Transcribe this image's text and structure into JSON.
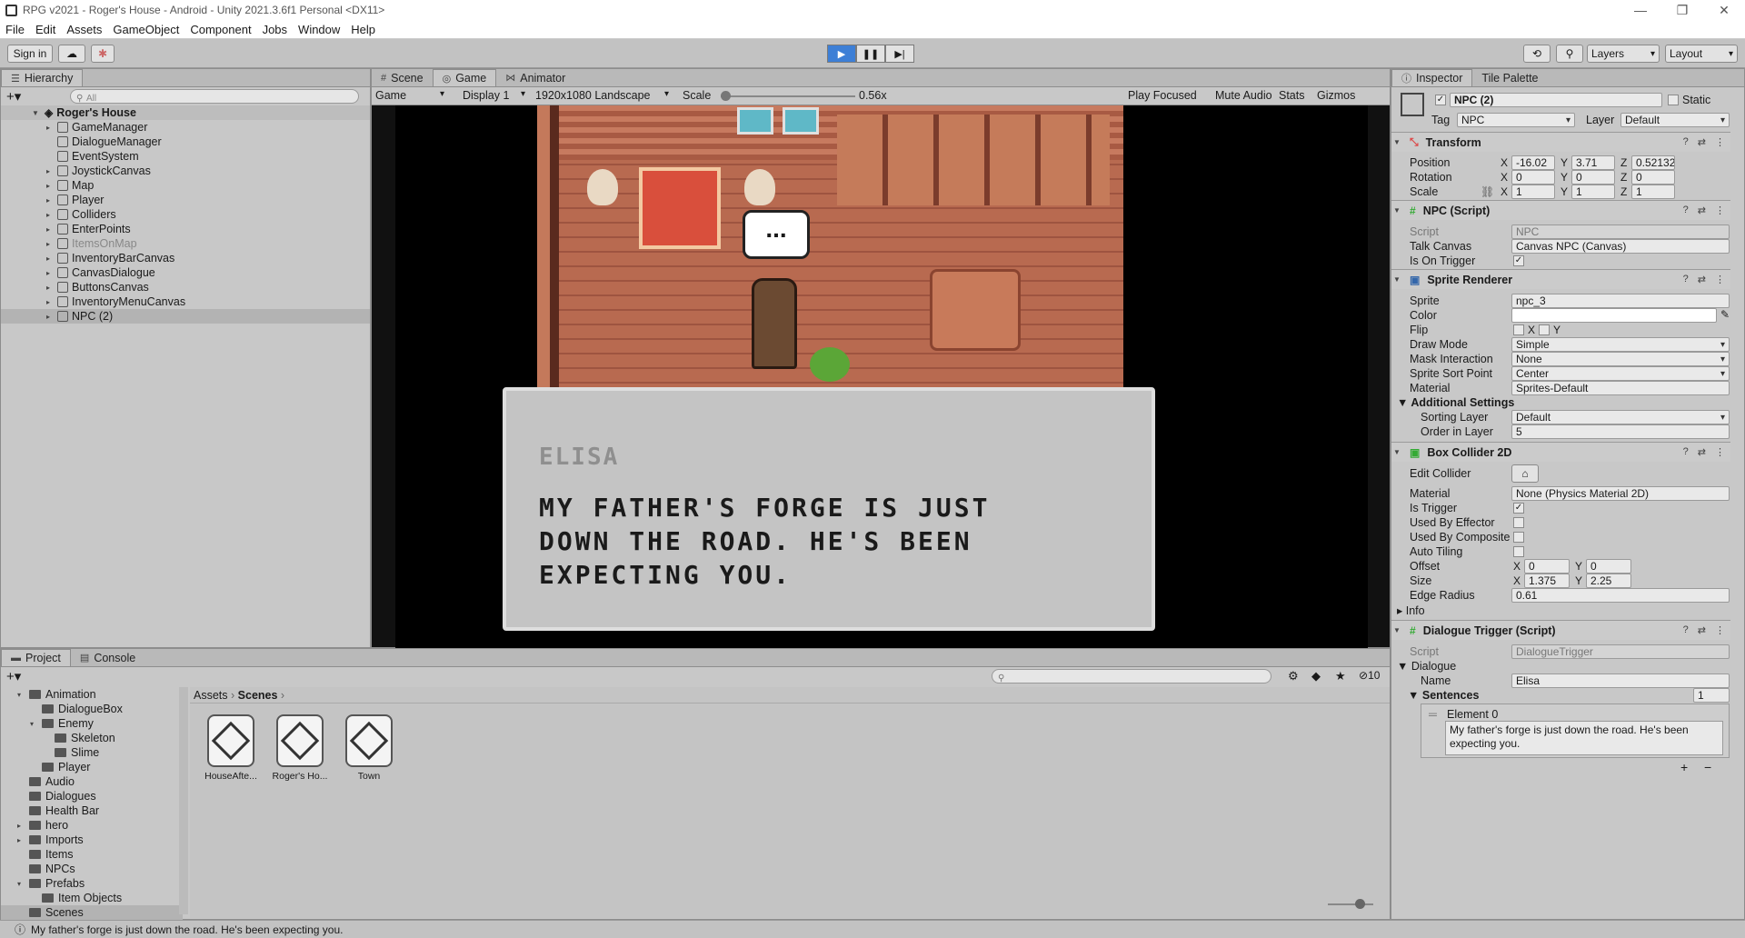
{
  "window": {
    "title": "RPG v2021 - Roger's House - Android - Unity 2021.3.6f1 Personal <DX11>"
  },
  "menu": [
    "File",
    "Edit",
    "Assets",
    "GameObject",
    "Component",
    "Jobs",
    "Window",
    "Help"
  ],
  "toolbar": {
    "sign_in": "Sign in",
    "layers": "Layers",
    "layout": "Layout"
  },
  "hierarchy": {
    "tab": "Hierarchy",
    "search_placeholder": "All",
    "scene": "Roger's House",
    "items": [
      {
        "label": "GameManager",
        "expand": true
      },
      {
        "label": "DialogueManager",
        "expand": false
      },
      {
        "label": "EventSystem",
        "expand": false
      },
      {
        "label": "JoystickCanvas",
        "expand": true
      },
      {
        "label": "Map",
        "expand": true
      },
      {
        "label": "Player",
        "expand": true
      },
      {
        "label": "Colliders",
        "expand": true
      },
      {
        "label": "EnterPoints",
        "expand": true
      },
      {
        "label": "ItemsOnMap",
        "expand": true,
        "disabled": true
      },
      {
        "label": "InventoryBarCanvas",
        "expand": true
      },
      {
        "label": "CanvasDialogue",
        "expand": true
      },
      {
        "label": "ButtonsCanvas",
        "expand": true
      },
      {
        "label": "InventoryMenuCanvas",
        "expand": true
      },
      {
        "label": "NPC (2)",
        "expand": true,
        "selected": true
      }
    ]
  },
  "center": {
    "tabs": [
      "Scene",
      "Game",
      "Animator"
    ],
    "game_label": "Game",
    "display": "Display 1",
    "resolution": "1920x1080 Landscape",
    "scale_label": "Scale",
    "scale_value": "0.56x",
    "scale_fraction": 0.0,
    "play_focused": "Play Focused",
    "mute": "Mute Audio",
    "stats": "Stats",
    "gizmos": "Gizmos",
    "dialogue": {
      "speaker": "ELISA",
      "line1": "MY FATHER'S FORGE IS JUST",
      "line2": "DOWN THE ROAD. HE'S BEEN",
      "line3": "EXPECTING YOU."
    },
    "speech_bubble": "..."
  },
  "inspector": {
    "tabs": [
      "Inspector",
      "Tile Palette"
    ],
    "object_name": "NPC (2)",
    "static": "Static",
    "tag_label": "Tag",
    "tag": "NPC",
    "layer_label": "Layer",
    "layer": "Default",
    "transform": {
      "title": "Transform",
      "position": "Position",
      "rotation": "Rotation",
      "scale": "Scale",
      "pos": [
        "-16.02",
        "3.71",
        "0.52132"
      ],
      "rot": [
        "0",
        "0",
        "0"
      ],
      "scl": [
        "1",
        "1",
        "1"
      ]
    },
    "npc_script": {
      "title": "NPC (Script)",
      "script_label": "Script",
      "script": "NPC",
      "talk_label": "Talk Canvas",
      "talk": "Canvas NPC (Canvas)",
      "trigger_label": "Is On Trigger"
    },
    "sprite_renderer": {
      "title": "Sprite Renderer",
      "sprite_label": "Sprite",
      "sprite": "npc_3",
      "color_label": "Color",
      "flip_label": "Flip",
      "flip_x": "X",
      "flip_y": "Y",
      "draw_label": "Draw Mode",
      "draw": "Simple",
      "mask_label": "Mask Interaction",
      "mask": "None",
      "sort_label": "Sprite Sort Point",
      "sort": "Center",
      "mat_label": "Material",
      "mat": "Sprites-Default",
      "additional": "Additional Settings",
      "sorting_layer_label": "Sorting Layer",
      "sorting_layer": "Default",
      "order_label": "Order in Layer",
      "order": "5"
    },
    "box_collider": {
      "title": "Box Collider 2D",
      "edit_label": "Edit Collider",
      "mat_label": "Material",
      "mat": "None (Physics Material 2D)",
      "trigger_label": "Is Trigger",
      "effector_label": "Used By Effector",
      "composite_label": "Used By Composite",
      "tiling_label": "Auto Tiling",
      "offset_label": "Offset",
      "offset": [
        "0",
        "0"
      ],
      "size_label": "Size",
      "size": [
        "1.375",
        "2.25"
      ],
      "edge_label": "Edge Radius",
      "edge": "0.61",
      "info": "Info"
    },
    "dialogue_trigger": {
      "title": "Dialogue Trigger (Script)",
      "script_label": "Script",
      "script": "DialogueTrigger",
      "dialogue_label": "Dialogue",
      "name_label": "Name",
      "name": "Elisa",
      "sentences_label": "Sentences",
      "sentences_count": "1",
      "element_label": "Element 0",
      "element_text": "My father's forge is just down the road. He's been expecting you."
    }
  },
  "project": {
    "tabs": [
      "Project",
      "Console"
    ],
    "count": "10",
    "breadcrumb": [
      "Assets",
      "Scenes"
    ],
    "tree": [
      {
        "label": "Animation",
        "depth": 0,
        "caret": "▾"
      },
      {
        "label": "DialogueBox",
        "depth": 1,
        "caret": ""
      },
      {
        "label": "Enemy",
        "depth": 1,
        "caret": "▾"
      },
      {
        "label": "Skeleton",
        "depth": 2,
        "caret": ""
      },
      {
        "label": "Slime",
        "depth": 2,
        "caret": ""
      },
      {
        "label": "Player",
        "depth": 1,
        "caret": ""
      },
      {
        "label": "Audio",
        "depth": 0,
        "caret": ""
      },
      {
        "label": "Dialogues",
        "depth": 0,
        "caret": ""
      },
      {
        "label": "Health Bar",
        "depth": 0,
        "caret": ""
      },
      {
        "label": "hero",
        "depth": 0,
        "caret": "▸"
      },
      {
        "label": "Imports",
        "depth": 0,
        "caret": "▸"
      },
      {
        "label": "Items",
        "depth": 0,
        "caret": ""
      },
      {
        "label": "NPCs",
        "depth": 0,
        "caret": ""
      },
      {
        "label": "Prefabs",
        "depth": 0,
        "caret": "▾"
      },
      {
        "label": "Item Objects",
        "depth": 1,
        "caret": ""
      },
      {
        "label": "Scenes",
        "depth": 0,
        "caret": "",
        "selected": true
      }
    ],
    "assets": [
      "HouseAfte...",
      "Roger's Ho...",
      "Town"
    ]
  },
  "status": "My father's forge is just down the road. He's been expecting you."
}
